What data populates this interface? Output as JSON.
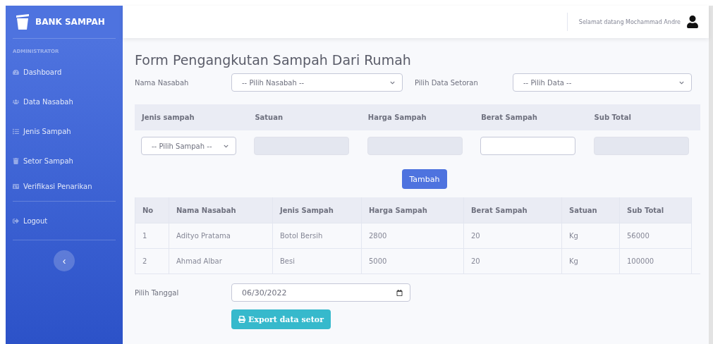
{
  "sidebar": {
    "brand": "BANK SAMPAH",
    "section": "ADMINISTRATOR",
    "items": [
      {
        "label": "Dashboard",
        "selected": false
      },
      {
        "label": "Data Nasabah",
        "selected": false
      },
      {
        "label": "Jenis Sampah",
        "selected": false
      },
      {
        "label": "Setor Sampah",
        "selected": false
      },
      {
        "label": "Verifikasi Penarikan",
        "selected": false
      }
    ],
    "logout": "Logout",
    "toggle": "‹"
  },
  "topbar": {
    "greeting": "Selamat datang Mochammad Andre"
  },
  "page_title": "Form Pengangkutan Sampah Dari Rumah",
  "filters": [
    {
      "label": "Nama Nasabah",
      "placeholder": "-- Pilih Nasabah --"
    },
    {
      "label": "Pilih Data Setoran",
      "placeholder": "-- Pilih Data --"
    }
  ],
  "entry": {
    "columns": [
      "Jenis sampah",
      "Satuan",
      "Harga Sampah",
      "Berat Sampah",
      "Sub Total"
    ],
    "fields": [
      {
        "kind": "select",
        "placeholder": "-- Pilih Sampah --",
        "disabled": false
      },
      {
        "kind": "text",
        "disabled": true
      },
      {
        "kind": "text",
        "disabled": true
      },
      {
        "kind": "text",
        "disabled": false
      },
      {
        "kind": "text",
        "disabled": true
      }
    ],
    "add_button": "Tambah"
  },
  "table": {
    "columns": [
      "No",
      "Nama Nasabah",
      "Jenis Sampah",
      "Harga Sampah",
      "Berat Sampah",
      "Satuan",
      "Sub Total"
    ],
    "rows": [
      [
        "1",
        "Adityo Pratama",
        "Botol Bersih",
        "2800",
        "20",
        "Kg",
        "56000"
      ],
      [
        "2",
        "Ahmad Albar",
        "Besi",
        "5000",
        "20",
        "Kg",
        "100000"
      ]
    ]
  },
  "date": {
    "label": "Pilih Tanggal",
    "value": "06/30/2022"
  },
  "export_button": "Export data setor"
}
